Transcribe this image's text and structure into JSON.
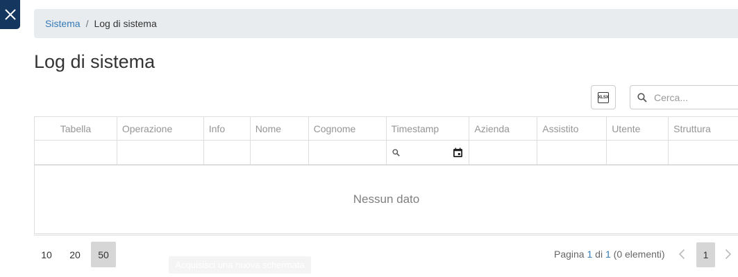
{
  "breadcrumb": {
    "parent": "Sistema",
    "separator": "/",
    "current": "Log di sistema"
  },
  "page": {
    "title": "Log di sistema"
  },
  "toolbar": {
    "export_icon_text": "XLSX",
    "search_placeholder": "Cerca..."
  },
  "grid": {
    "columns": [
      "Tabella",
      "Operazione",
      "Info",
      "Nome",
      "Cognome",
      "Timestamp",
      "Azienda",
      "Assistito",
      "Utente",
      "Struttura"
    ],
    "no_data": "Nessun dato"
  },
  "pager": {
    "sizes": [
      "10",
      "20",
      "50"
    ],
    "selected_size": "50",
    "info_prefix": "Pagina ",
    "info_current": "1",
    "info_middle": " di ",
    "info_total": "1",
    "info_suffix": " (0 elementi)",
    "current_page": "1"
  },
  "tooltip": {
    "text": "Acquisisci una nuova schermata"
  },
  "icons": {
    "close": "close-icon",
    "export": "xlsx-export-icon",
    "search": "search-icon",
    "filter_search": "search-icon",
    "calendar": "calendar-icon",
    "prev": "chevron-left-icon",
    "next": "chevron-right-icon"
  },
  "colors": {
    "close_bg": "#15365e",
    "link": "#337ab7",
    "breadcrumb_bg": "#e9ecef",
    "active_page_bg": "#d6d6d6"
  }
}
